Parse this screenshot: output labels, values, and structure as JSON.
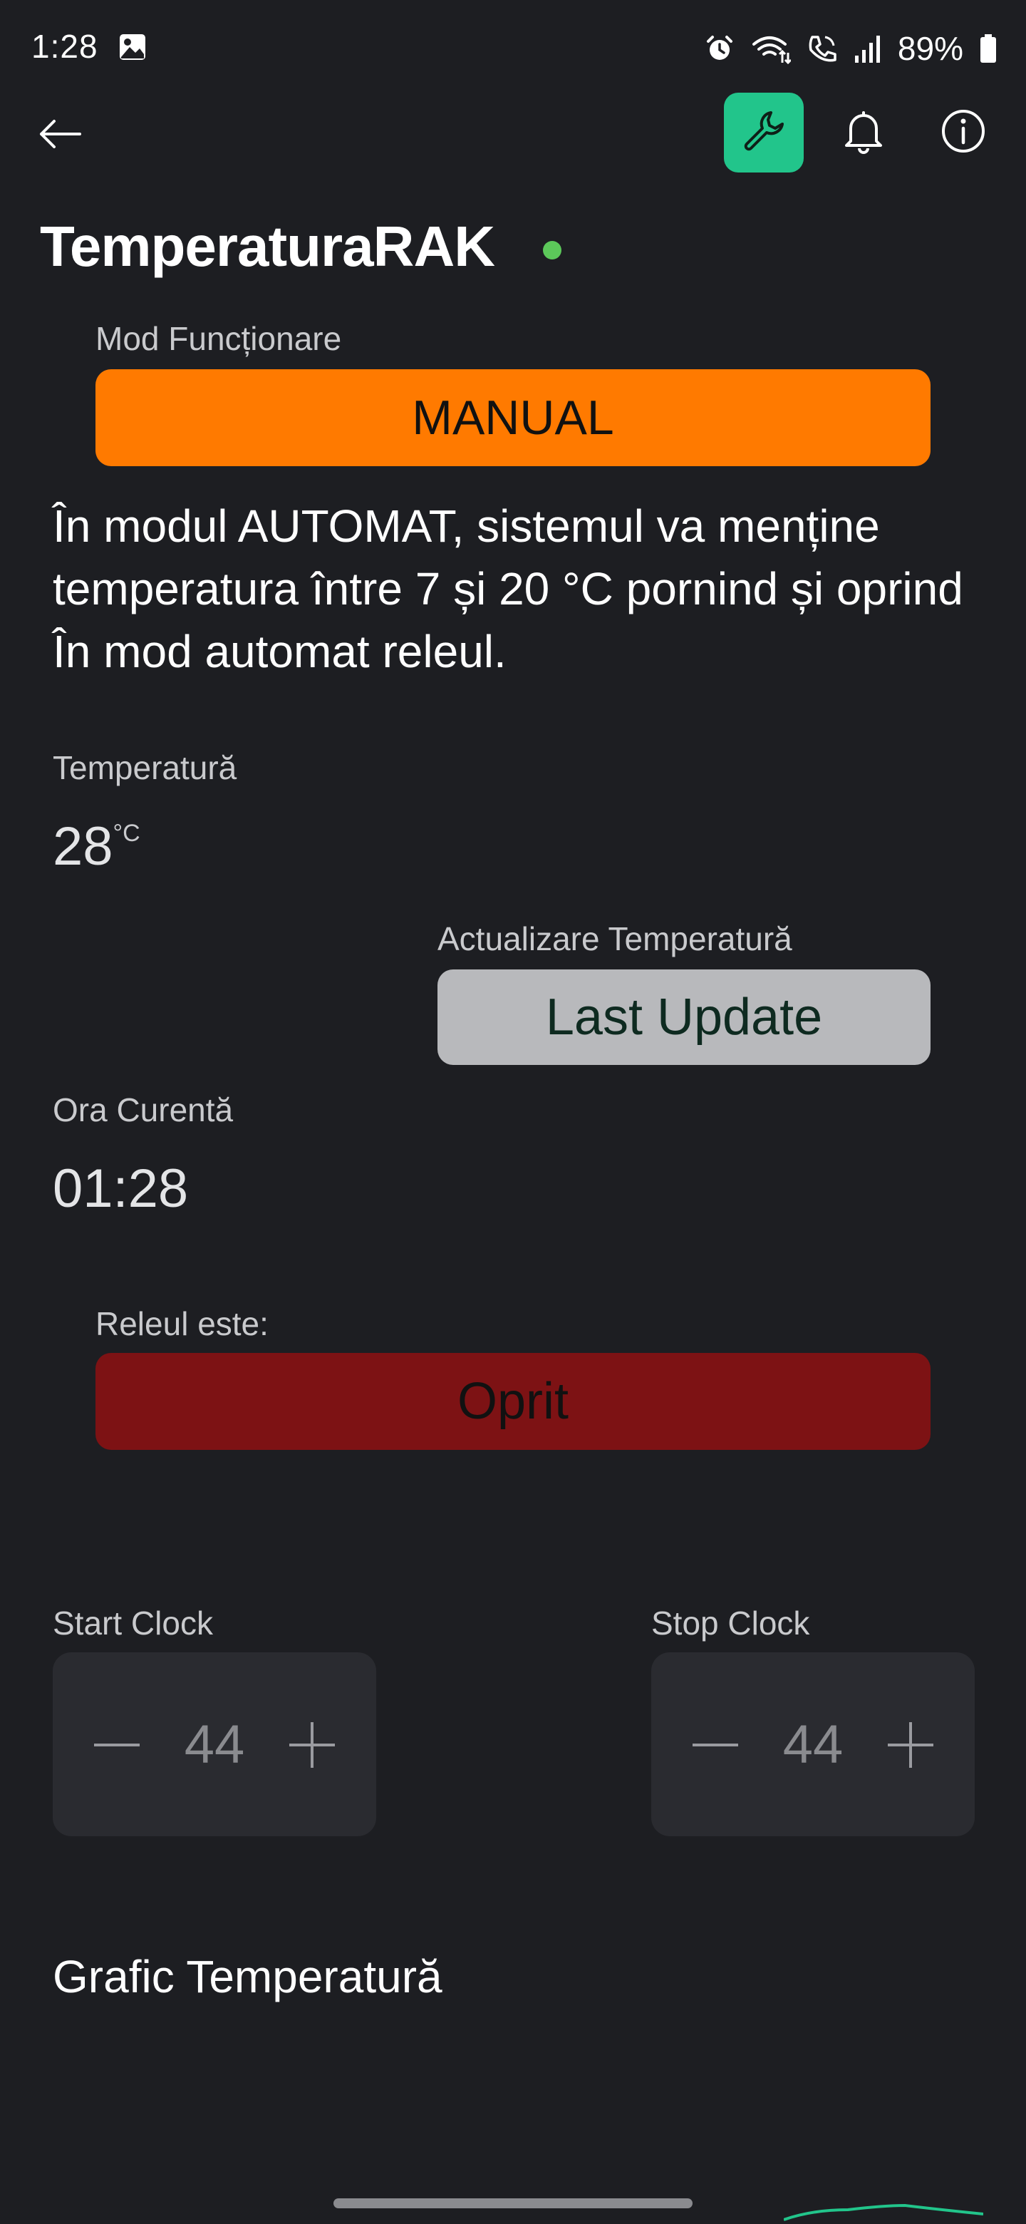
{
  "status_bar": {
    "time": "1:28",
    "battery": "89%",
    "icons": [
      "gallery-icon",
      "alarm-icon",
      "wifi-icon",
      "wifi-call-icon",
      "signal-icon",
      "battery-icon"
    ]
  },
  "app_bar": {
    "icons": [
      "back-arrow-icon",
      "wrench-icon",
      "bell-icon",
      "info-icon"
    ],
    "accent_color": "#22c58b"
  },
  "device": {
    "title": "TemperaturaRAK",
    "status_color": "#5cc85a"
  },
  "mode": {
    "label": "Mod Funcționare",
    "value": "MANUAL",
    "color": "#ff7a00"
  },
  "description": "În modul AUTOMAT, sistemul va menține temperatura între 7 și 20 °C pornind și oprind În mod automat releul.",
  "temperature": {
    "label": "Temperatură",
    "value": "28",
    "unit": "°C"
  },
  "update": {
    "label": "Actualizare Temperatură",
    "button": "Last Update"
  },
  "clock": {
    "label": "Ora Curentă",
    "value": "01:28"
  },
  "relay": {
    "label": "Releul este:",
    "value": "Oprit",
    "color": "#7d1214"
  },
  "start_clock": {
    "label": "Start Clock",
    "value": "44"
  },
  "stop_clock": {
    "label": "Stop Clock",
    "value": "44"
  },
  "chart": {
    "title": "Grafic Temperatură"
  }
}
